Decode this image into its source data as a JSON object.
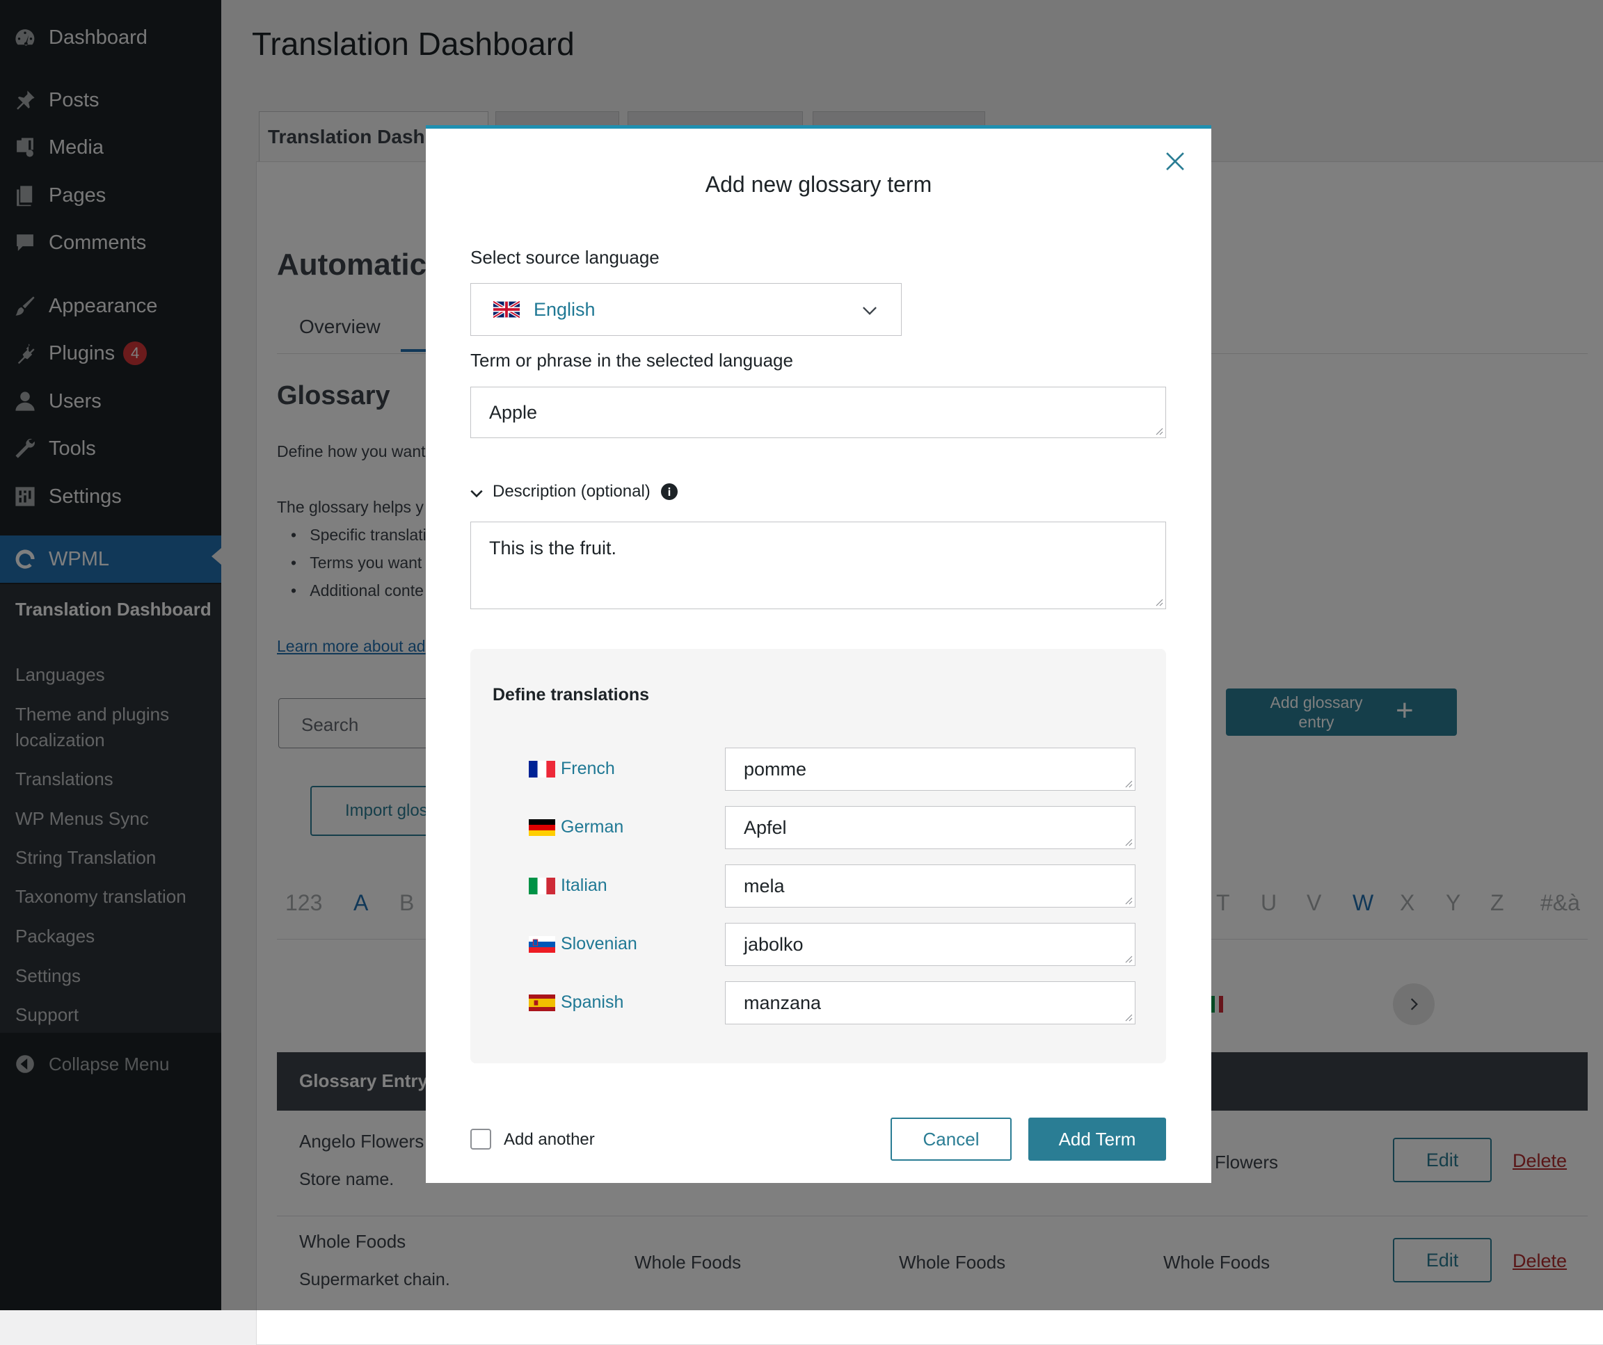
{
  "sidebar": {
    "menu": [
      {
        "label": "Dashboard",
        "icon": "dashboard-icon"
      },
      {
        "label": "Posts",
        "icon": "pin-icon"
      },
      {
        "label": "Media",
        "icon": "media-icon"
      },
      {
        "label": "Pages",
        "icon": "pages-icon"
      },
      {
        "label": "Comments",
        "icon": "comment-icon"
      },
      {
        "label": "Appearance",
        "icon": "brush-icon"
      },
      {
        "label": "Plugins",
        "icon": "plugin-icon",
        "badge": "4"
      },
      {
        "label": "Users",
        "icon": "user-icon"
      },
      {
        "label": "Tools",
        "icon": "wrench-icon"
      },
      {
        "label": "Settings",
        "icon": "settings-icon"
      },
      {
        "label": "WPML",
        "icon": "wpml-icon"
      }
    ],
    "submenu": [
      {
        "label": "Translation Dashboard"
      },
      {
        "label": "Languages"
      },
      {
        "label": "Theme and plugins localization"
      },
      {
        "label": "Translations"
      },
      {
        "label": "WP Menus Sync"
      },
      {
        "label": "String Translation"
      },
      {
        "label": "Taxonomy translation"
      },
      {
        "label": "Packages"
      },
      {
        "label": "Settings"
      },
      {
        "label": "Support"
      }
    ],
    "collapse_label": "Collapse Menu"
  },
  "main": {
    "page_title": "Translation Dashboard",
    "tab_first": "Translation Dashboard",
    "section_heading": "Automatic",
    "subtab_overview": "Overview",
    "glossary_heading": "Glossary",
    "define_text": "Define how you want",
    "helps_text": "The glossary helps y",
    "bullets": [
      "Specific translati",
      "Terms you want t",
      "Additional conte"
    ],
    "learn_more": "Learn more about ad",
    "search_placeholder": "Search",
    "import_label": "Import glos",
    "add_entry_label": "Add glossary entry",
    "alphabet": [
      "123",
      "A",
      "B",
      "T",
      "U",
      "V",
      "W",
      "X",
      "Y",
      "Z",
      "#&à"
    ],
    "table_header": "Glossary Entry",
    "rows": [
      {
        "term": "Angelo Flowers",
        "desc": "Store name.",
        "t3": "Flowers",
        "edit": "Edit",
        "delete": "Delete"
      },
      {
        "term": "Whole Foods",
        "desc": "Supermarket chain.",
        "t1": "Whole Foods",
        "t2": "Whole Foods",
        "t3": "Whole Foods",
        "edit": "Edit",
        "delete": "Delete"
      }
    ]
  },
  "modal": {
    "title": "Add new glossary term",
    "source_label": "Select source language",
    "source_value": "English",
    "term_label": "Term or phrase in the selected language",
    "term_value": "Apple",
    "description_label": "Description (optional)",
    "description_value": "This is the fruit.",
    "translations_heading": "Define translations",
    "translations": [
      {
        "language": "French",
        "value": "pomme"
      },
      {
        "language": "German",
        "value": "Apfel"
      },
      {
        "language": "Italian",
        "value": "mela"
      },
      {
        "language": "Slovenian",
        "value": "jabolko"
      },
      {
        "language": "Spanish",
        "value": "manzana"
      }
    ],
    "add_another_label": "Add another",
    "cancel_label": "Cancel",
    "submit_label": "Add Term"
  },
  "colors": {
    "accent": "#2a7d94",
    "sidebar_bg": "#1d2327",
    "wp_blue": "#2271b1",
    "delete_red": "#b32d2e"
  }
}
